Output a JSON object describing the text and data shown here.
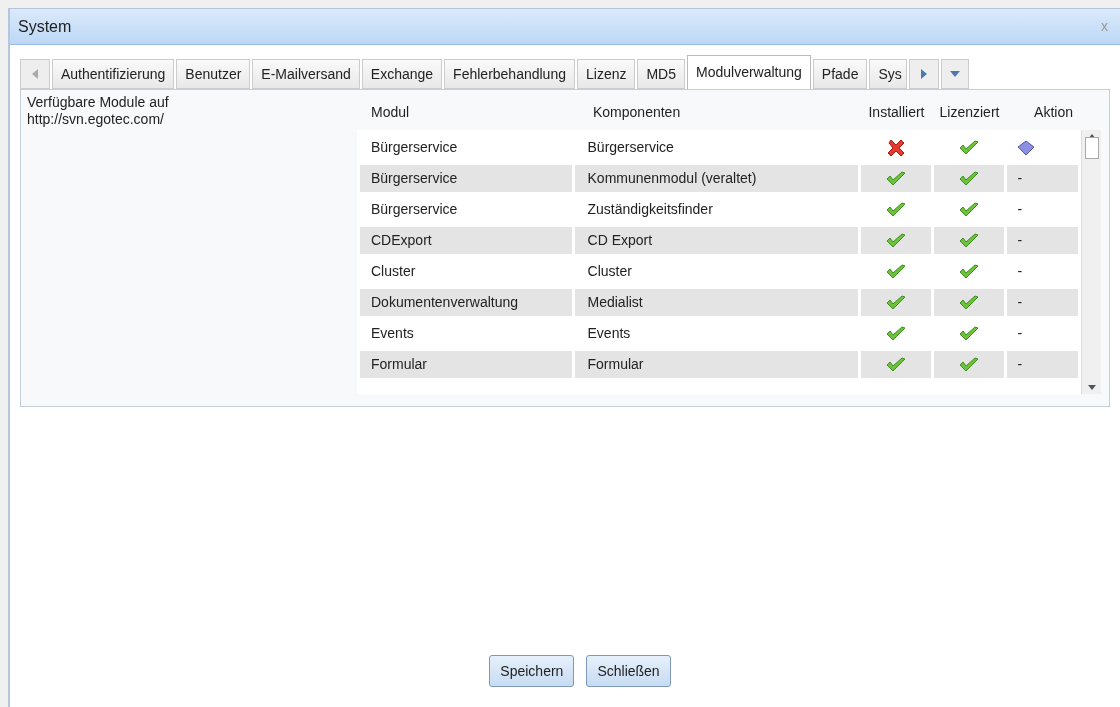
{
  "window": {
    "title": "System",
    "close": "x"
  },
  "tabs": [
    {
      "label": "Authentifizierung",
      "selected": false
    },
    {
      "label": "Benutzer",
      "selected": false
    },
    {
      "label": "E-Mailversand",
      "selected": false
    },
    {
      "label": "Exchange",
      "selected": false
    },
    {
      "label": "Fehlerbehandlung",
      "selected": false
    },
    {
      "label": "Lizenz",
      "selected": false
    },
    {
      "label": "MD5",
      "selected": false
    },
    {
      "label": "Modulverwaltung",
      "selected": true
    },
    {
      "label": "Pfade",
      "selected": false
    },
    {
      "label": "Sys",
      "selected": false
    }
  ],
  "source": {
    "label": "Verfügbare Module auf",
    "url": "http://svn.egotec.com/"
  },
  "table": {
    "columns": [
      "Modul",
      "Komponenten",
      "Installiert",
      "Lizenziert",
      "Aktion"
    ],
    "rows": [
      {
        "module": "Bürgerservice",
        "component": "Bürgerservice",
        "installed": false,
        "licensed": true,
        "action": {
          "kind": "icon"
        }
      },
      {
        "module": "Bürgerservice",
        "component": "Kommunenmodul (veraltet)",
        "installed": true,
        "licensed": true,
        "action": {
          "kind": "text",
          "text": "-"
        }
      },
      {
        "module": "Bürgerservice",
        "component": "Zuständigkeitsfinder",
        "installed": true,
        "licensed": true,
        "action": {
          "kind": "text",
          "text": "-"
        }
      },
      {
        "module": "CDExport",
        "component": "CD Export",
        "installed": true,
        "licensed": true,
        "action": {
          "kind": "text",
          "text": "-"
        }
      },
      {
        "module": "Cluster",
        "component": "Cluster",
        "installed": true,
        "licensed": true,
        "action": {
          "kind": "text",
          "text": "-"
        }
      },
      {
        "module": "Dokumentenverwaltung",
        "component": "Medialist",
        "installed": true,
        "licensed": true,
        "action": {
          "kind": "text",
          "text": "-"
        }
      },
      {
        "module": "Events",
        "component": "Events",
        "installed": true,
        "licensed": true,
        "action": {
          "kind": "text",
          "text": "-"
        }
      },
      {
        "module": "Formular",
        "component": "Formular",
        "installed": true,
        "licensed": true,
        "action": {
          "kind": "text",
          "text": "-"
        }
      }
    ]
  },
  "buttons": [
    "Speichern",
    "Schließen"
  ]
}
